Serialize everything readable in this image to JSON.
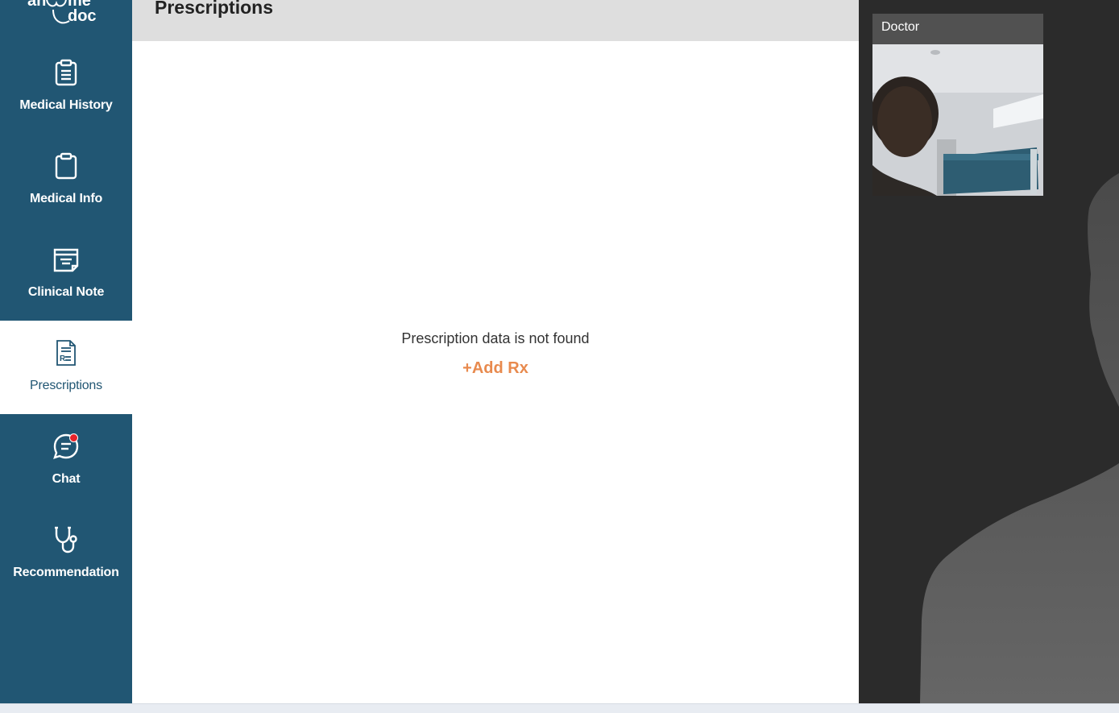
{
  "sidebar": {
    "logo_text": "anytime doc",
    "items": [
      {
        "label": "Medical History",
        "icon": "clipboard-list-icon",
        "active": false
      },
      {
        "label": "Medical Info",
        "icon": "clipboard-icon",
        "active": false
      },
      {
        "label": "Clinical Note",
        "icon": "note-icon",
        "active": false
      },
      {
        "label": "Prescriptions",
        "icon": "prescription-icon",
        "active": true
      },
      {
        "label": "Chat",
        "icon": "chat-icon",
        "active": false,
        "has_notification": true
      },
      {
        "label": "Recommendation",
        "icon": "stethoscope-icon",
        "active": false
      }
    ]
  },
  "main": {
    "title": "Prescriptions",
    "empty_message": "Prescription data is not found",
    "add_button_label": "+Add Rx"
  },
  "video": {
    "pip_label": "Doctor"
  },
  "colors": {
    "sidebar_bg": "#215673",
    "accent": "#e88a4e",
    "header_bg": "#dedede",
    "video_bg": "#2b2b2b",
    "notification": "#e8232a"
  }
}
